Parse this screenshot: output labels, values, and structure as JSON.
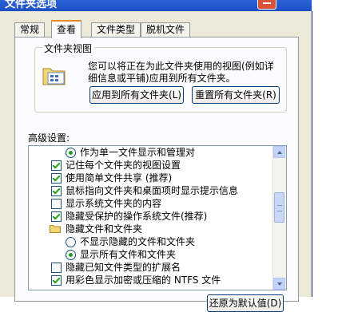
{
  "window": {
    "title": "文件夹选项"
  },
  "tabs": [
    {
      "label": "常规",
      "active": false
    },
    {
      "label": "查看",
      "active": true
    },
    {
      "label": "文件类型",
      "active": false
    },
    {
      "label": "脱机文件",
      "active": false
    }
  ],
  "folder_views": {
    "group_label": "文件夹视图",
    "description": "您可以将正在为此文件夹使用的视图(例如详细信息或平铺)应用到所有文件夹。",
    "apply_all_label": "应用到所有文件夹(L)",
    "reset_all_label": "重置所有文件夹(R)"
  },
  "advanced": {
    "label": "高级设置:",
    "items": [
      {
        "type": "radio",
        "checked": true,
        "level": 1,
        "label": "作为单一文件显示和管理对"
      },
      {
        "type": "checkbox",
        "checked": true,
        "level": 0,
        "label": "记住每个文件夹的视图设置"
      },
      {
        "type": "checkbox",
        "checked": true,
        "level": 0,
        "label": "使用简单文件共享 (推荐)"
      },
      {
        "type": "checkbox",
        "checked": true,
        "level": 0,
        "label": "鼠标指向文件夹和桌面项时显示提示信息"
      },
      {
        "type": "checkbox",
        "checked": false,
        "level": 0,
        "label": "显示系统文件夹的内容"
      },
      {
        "type": "checkbox",
        "checked": true,
        "level": 0,
        "label": "隐藏受保护的操作系统文件(推荐)"
      },
      {
        "type": "folder",
        "checked": false,
        "level": 0,
        "label": "隐藏文件和文件夹"
      },
      {
        "type": "radio",
        "checked": false,
        "level": 1,
        "label": "不显示隐藏的文件和文件夹"
      },
      {
        "type": "radio",
        "checked": true,
        "level": 1,
        "label": "显示所有文件和文件夹"
      },
      {
        "type": "checkbox",
        "checked": false,
        "level": 0,
        "label": "隐藏已知文件类型的扩展名"
      },
      {
        "type": "checkbox",
        "checked": true,
        "level": 0,
        "label": "用彩色显示加密或压缩的 NTFS 文件"
      }
    ]
  },
  "footer": {
    "restore_defaults_label": "还原为默认值(D)"
  },
  "colors": {
    "titlebar": "#1b4fc2",
    "dialog": "#ece9d8",
    "tab_highlight": "#e68b2c",
    "check": "#21a121"
  }
}
